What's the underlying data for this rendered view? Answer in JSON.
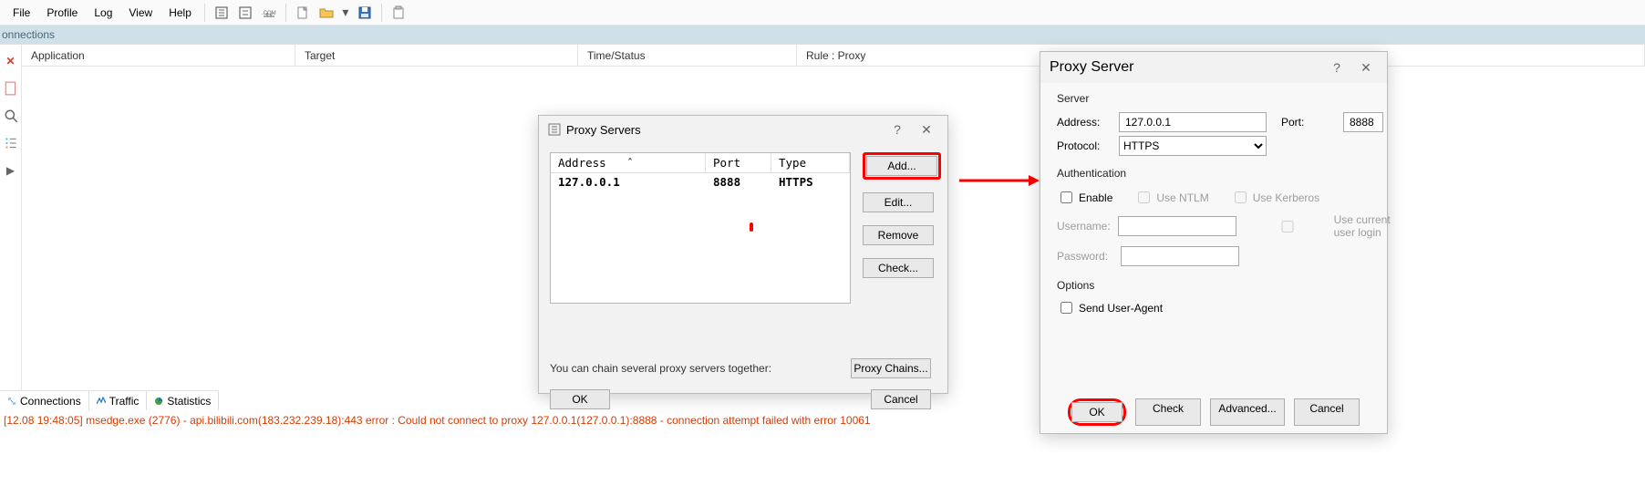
{
  "menubar": {
    "items": [
      "File",
      "Profile",
      "Log",
      "View",
      "Help"
    ]
  },
  "connections_band": "onnections",
  "grid": {
    "columns": [
      "Application",
      "Target",
      "Time/Status",
      "Rule : Proxy"
    ]
  },
  "bottom_tabs": {
    "connections": "Connections",
    "traffic": "Traffic",
    "statistics": "Statistics"
  },
  "status_error": "[12.08 19:48:05] msedge.exe (2776) - api.bilibili.com(183.232.239.18):443 error : Could not connect to proxy 127.0.0.1(127.0.0.1):8888 - connection attempt failed with error 10061",
  "servers_dialog": {
    "title": "Proxy Servers",
    "columns": {
      "address": "Address",
      "port": "Port",
      "type": "Type"
    },
    "rows": [
      {
        "address": "127.0.0.1",
        "port": "8888",
        "type": "HTTPS"
      }
    ],
    "buttons": {
      "add": "Add...",
      "edit": "Edit...",
      "remove": "Remove",
      "check": "Check..."
    },
    "chain_text": "You can chain several proxy servers together:",
    "chain_btn": "Proxy Chains...",
    "ok": "OK",
    "cancel": "Cancel"
  },
  "server_dialog": {
    "title": "Proxy Server",
    "group_server": "Server",
    "address_label": "Address:",
    "address_value": "127.0.0.1",
    "port_label": "Port:",
    "port_value": "8888",
    "protocol_label": "Protocol:",
    "protocol_value": "HTTPS",
    "group_auth": "Authentication",
    "enable": "Enable",
    "use_ntlm": "Use NTLM",
    "use_kerberos": "Use Kerberos",
    "username_label": "Username:",
    "use_current": "Use current user login",
    "password_label": "Password:",
    "group_options": "Options",
    "send_ua": "Send User-Agent",
    "ok": "OK",
    "check": "Check",
    "advanced": "Advanced...",
    "cancel": "Cancel"
  }
}
